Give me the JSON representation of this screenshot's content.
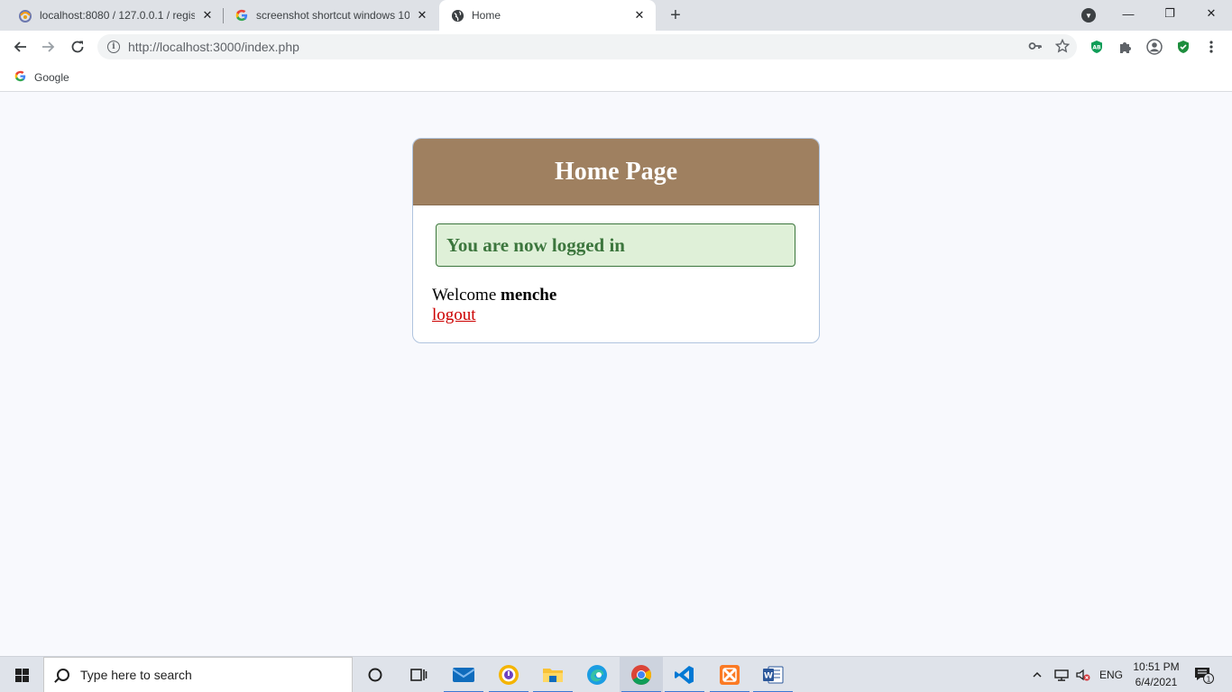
{
  "browser": {
    "tabs": [
      {
        "title": "localhost:8080 / 127.0.0.1 / regist",
        "icon": "phpmyadmin-icon"
      },
      {
        "title": "screenshot shortcut windows 10",
        "icon": "google-icon"
      },
      {
        "title": "Home",
        "icon": "globe-icon"
      }
    ],
    "new_tab": "+",
    "url_host": "http://localhost:3000",
    "url_path": "/index.php",
    "bookmarks": [
      {
        "label": "Google"
      }
    ],
    "window_controls": {
      "minimize": "—",
      "restore": "❐",
      "close": "✕"
    }
  },
  "page": {
    "header_title": "Home Page",
    "success_message": "You are now logged in",
    "welcome_prefix": "Welcome",
    "username": "menche",
    "logout_label": "logout"
  },
  "taskbar": {
    "search_placeholder": "Type here to search",
    "language": "ENG",
    "time": "10:51 PM",
    "date": "6/4/2021",
    "notification_count": "1"
  },
  "colors": {
    "header_bg": "#9f8060",
    "success_bg": "#dff0d8",
    "success_text": "#3c763d",
    "logout_link": "#cc0000"
  }
}
